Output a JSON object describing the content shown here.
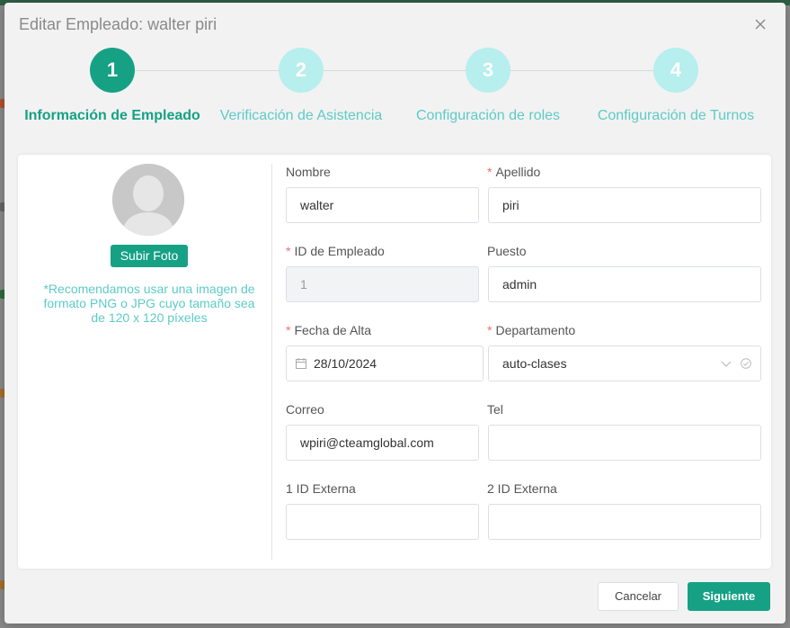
{
  "modal": {
    "title": "Editar Empleado: walter piri"
  },
  "steps": [
    {
      "number": "1",
      "label": "Información de Empleado",
      "state": "active"
    },
    {
      "number": "2",
      "label": "Verificación de Asistencia",
      "state": "pending"
    },
    {
      "number": "3",
      "label": "Configuración de roles",
      "state": "pending"
    },
    {
      "number": "4",
      "label": "Configuración de Turnos",
      "state": "pending"
    }
  ],
  "photo": {
    "upload_label": "Subir Foto",
    "hint": "*Recomendamos usar una imagen de formato PNG o JPG cuyo tamaño sea de 120 x 120 píxeles"
  },
  "form": {
    "nombre": {
      "label": "Nombre",
      "value": "walter",
      "required": false
    },
    "apellido": {
      "label": "Apellido",
      "value": "piri",
      "required": true
    },
    "id_empleado": {
      "label": "ID de Empleado",
      "value": "1",
      "required": true
    },
    "puesto": {
      "label": "Puesto",
      "value": "admin",
      "required": false
    },
    "fecha_alta": {
      "label": "Fecha de Alta",
      "value": "28/10/2024",
      "required": true
    },
    "departamento": {
      "label": "Departamento",
      "value": "auto-clases",
      "required": true
    },
    "correo": {
      "label": "Correo",
      "value": "wpiri@cteamglobal.com",
      "required": false
    },
    "tel": {
      "label": "Tel",
      "value": "",
      "required": false
    },
    "id_externa_1": {
      "label": "1 ID Externa",
      "value": "",
      "required": false
    },
    "id_externa_2": {
      "label": "2 ID Externa",
      "value": "",
      "required": false
    }
  },
  "footer": {
    "cancel_label": "Cancelar",
    "next_label": "Siguiente"
  },
  "colors": {
    "primary": "#16a185",
    "step_pending": "#b7eeee",
    "step_pending_text": "#5dcbc6",
    "required": "#f56c6c"
  }
}
